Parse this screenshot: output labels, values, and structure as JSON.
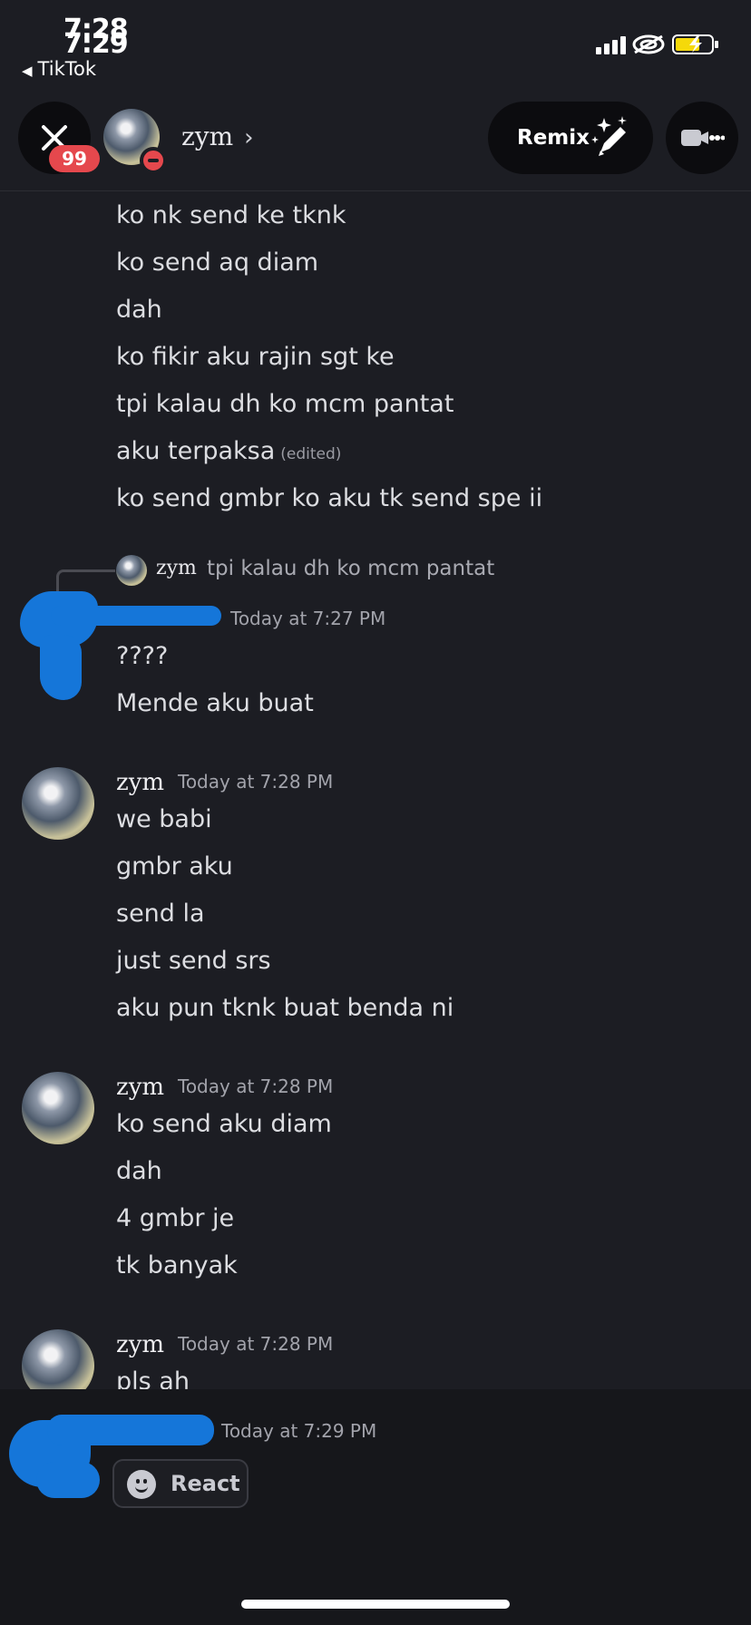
{
  "status_bar": {
    "time_old": "7:28",
    "time_new": "7:29",
    "back_app": "TikTok"
  },
  "header": {
    "badge_count": "99",
    "name": "zym",
    "remix_label": "Remix"
  },
  "messages_top": [
    {
      "text": "ko nk send ke tknk"
    },
    {
      "text": "ko send aq diam"
    },
    {
      "text": "dah"
    },
    {
      "text": "ko fikir aku rajin sgt ke"
    },
    {
      "text": "tpi kalau dh ko mcm pantat"
    },
    {
      "text": "aku terpaksa",
      "edited": "(edited)"
    },
    {
      "text": "ko send gmbr ko aku tk send spe ii"
    }
  ],
  "reply": {
    "name": "zym",
    "text": "tpi kalau dh ko mcm pantat"
  },
  "group1": {
    "timestamp": "Today at 7:27 PM",
    "lines": [
      "????",
      "Mende aku buat"
    ]
  },
  "group2": {
    "name": "zym",
    "timestamp": "Today at 7:28 PM",
    "lines": [
      "we babi",
      "gmbr aku",
      "send la",
      "just send srs",
      "aku pun tknk buat benda ni"
    ]
  },
  "group3": {
    "name": "zym",
    "timestamp": "Today at 7:28 PM",
    "lines": [
      "ko send aku diam",
      "dah",
      "4 gmbr je",
      "tk banyak"
    ]
  },
  "group4": {
    "name": "zym",
    "timestamp": "Today at 7:28 PM",
    "lines": [
      "pls ah"
    ]
  },
  "bottom": {
    "timestamp": "Today at 7:29 PM",
    "react_label": "React"
  },
  "colors": {
    "background": "#1c1d23",
    "accent_red": "#e5484d",
    "scribble_blue": "#1576d9"
  }
}
